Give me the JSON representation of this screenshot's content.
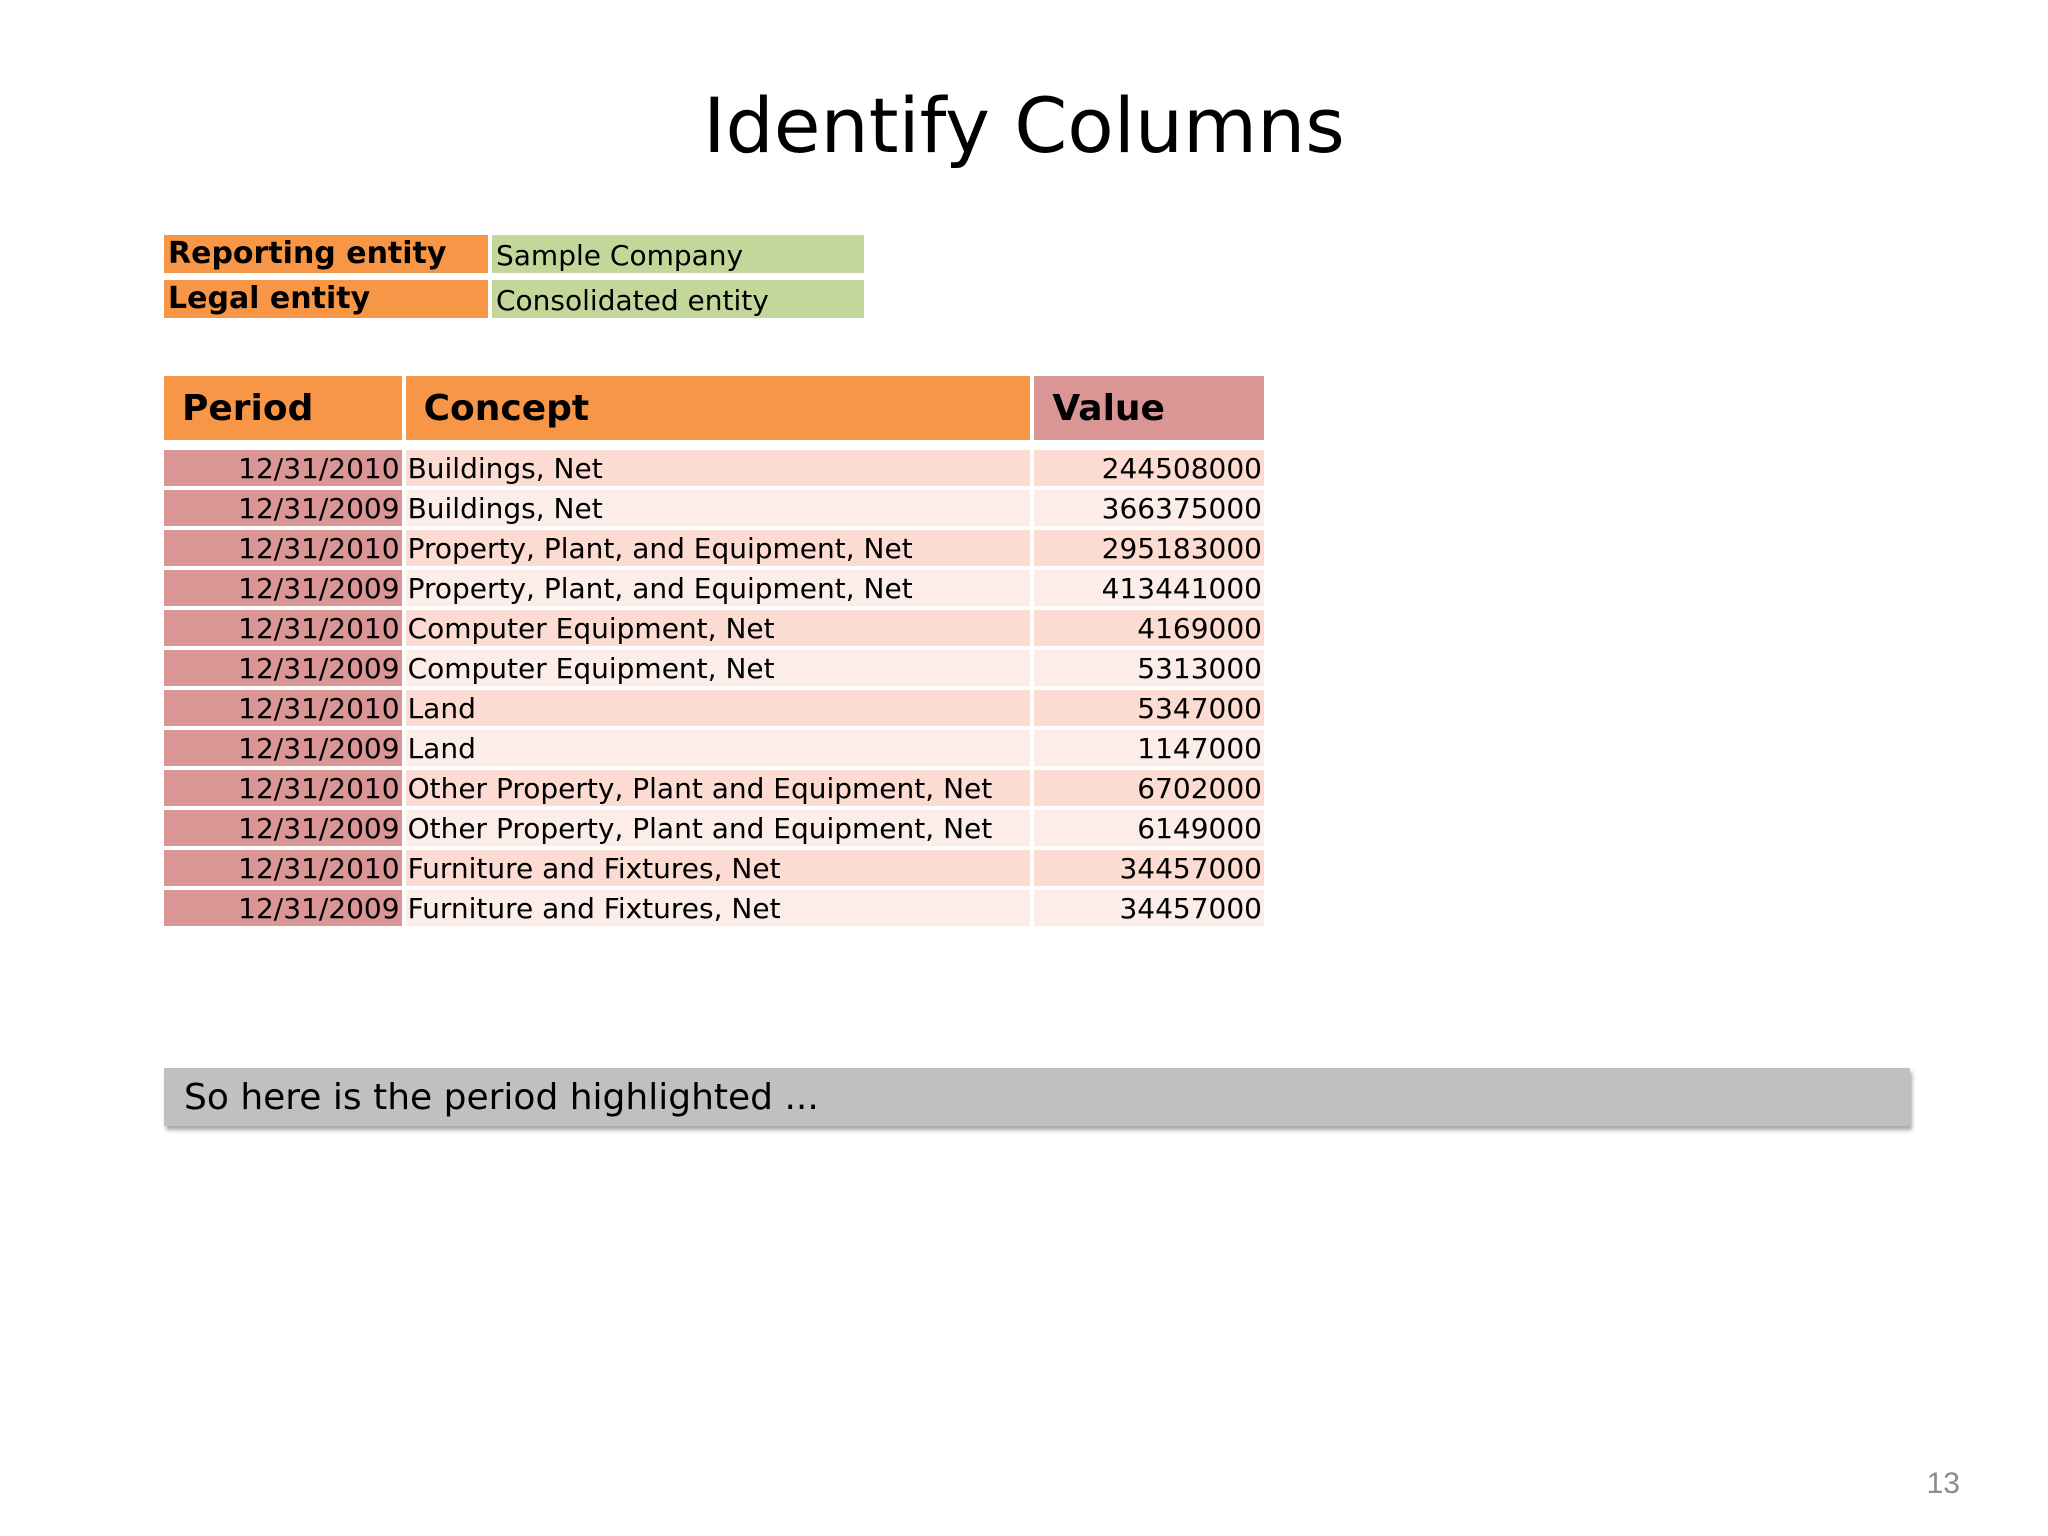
{
  "slide": {
    "title": "Identify Columns",
    "page_number": "13"
  },
  "entities": [
    {
      "label": "Reporting entity",
      "value": "Sample Company"
    },
    {
      "label": "Legal entity",
      "value": "Consolidated entity"
    }
  ],
  "table": {
    "headers": {
      "period": "Period",
      "concept": "Concept",
      "value": "Value"
    },
    "rows": [
      {
        "period": "12/31/2010",
        "concept": "Buildings, Net",
        "value": "244508000"
      },
      {
        "period": "12/31/2009",
        "concept": "Buildings, Net",
        "value": "366375000"
      },
      {
        "period": "12/31/2010",
        "concept": "Property, Plant, and Equipment, Net",
        "value": "295183000"
      },
      {
        "period": "12/31/2009",
        "concept": "Property, Plant, and Equipment, Net",
        "value": "413441000"
      },
      {
        "period": "12/31/2010",
        "concept": "Computer Equipment, Net",
        "value": "4169000"
      },
      {
        "period": "12/31/2009",
        "concept": "Computer Equipment, Net",
        "value": "5313000"
      },
      {
        "period": "12/31/2010",
        "concept": "Land",
        "value": "5347000"
      },
      {
        "period": "12/31/2009",
        "concept": "Land",
        "value": "1147000"
      },
      {
        "period": "12/31/2010",
        "concept": "Other Property, Plant and Equipment, Net",
        "value": "6702000"
      },
      {
        "period": "12/31/2009",
        "concept": "Other Property, Plant and Equipment, Net",
        "value": "6149000"
      },
      {
        "period": "12/31/2010",
        "concept": "Furniture and Fixtures, Net",
        "value": "34457000"
      },
      {
        "period": "12/31/2009",
        "concept": "Furniture and Fixtures, Net",
        "value": "34457000"
      }
    ]
  },
  "caption": {
    "text": "So here is the period highlighted ..."
  },
  "colors": {
    "header_orange": "#f79646",
    "value_header_rose": "#da9694",
    "entity_green": "#c4d79b",
    "row_light_1": "#fcdcd2",
    "row_light_2": "#fdede8",
    "caption_gray": "#c0bfc1"
  }
}
